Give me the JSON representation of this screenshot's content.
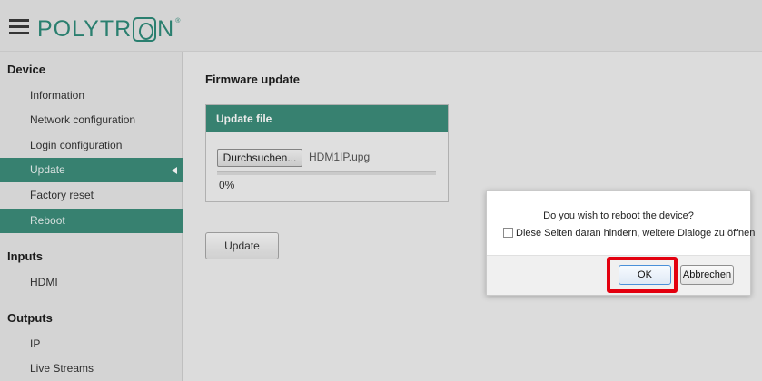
{
  "header": {
    "brand": "POLYTRON",
    "brand_pre": "POLYTR",
    "brand_post": "N",
    "reg_mark": "®"
  },
  "sidebar": {
    "sections": [
      {
        "title": "Device"
      },
      {
        "title": "Inputs"
      },
      {
        "title": "Outputs"
      }
    ],
    "items": [
      {
        "label": "Information"
      },
      {
        "label": "Network configuration"
      },
      {
        "label": "Login configuration"
      },
      {
        "label": "Update",
        "selected": true
      },
      {
        "label": "Factory reset"
      },
      {
        "label": "Reboot",
        "highlighted": true
      },
      {
        "label": "HDMI"
      },
      {
        "label": "IP"
      },
      {
        "label": "Live Streams"
      }
    ]
  },
  "main": {
    "title": "Firmware update",
    "panel": {
      "header": "Update file",
      "browse_label": "Durchsuchen...",
      "filename": "HDM1IP.upg",
      "progress": 0,
      "progress_text": "0%"
    },
    "update_label": "Update"
  },
  "dialog": {
    "message": "Do you wish to reboot the device?",
    "checkbox_label": "Diese Seiten daran hindern, weitere Dialoge zu öffnen",
    "checkbox_checked": false,
    "ok_label": "OK",
    "cancel_label": "Abbrechen"
  },
  "colors": {
    "accent": "#3c8c7a",
    "highlight": "#e3000f"
  },
  "icons": {
    "menu": "hamburger-menu-icon",
    "caret": "caret-left-icon",
    "logo": "polytron-logo"
  }
}
